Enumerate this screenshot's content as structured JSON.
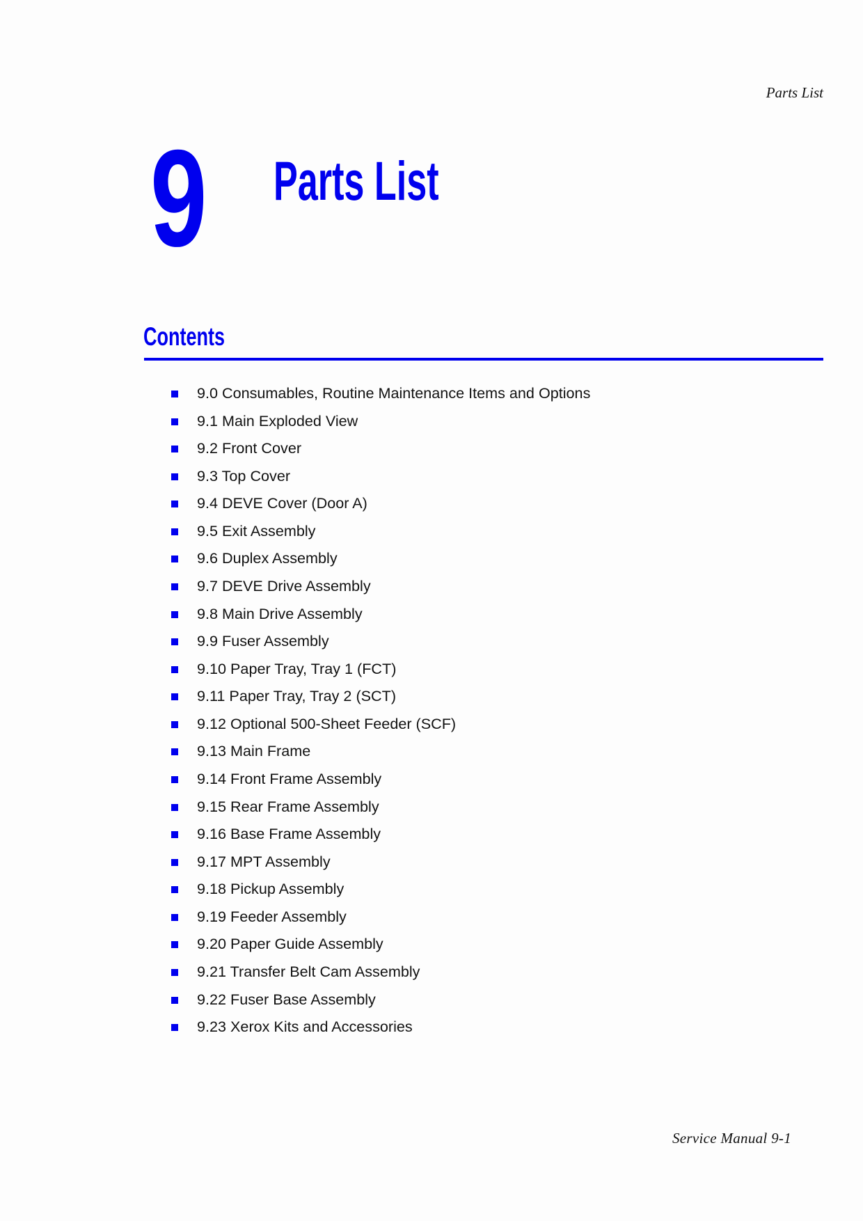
{
  "header": {
    "running_title": "Parts List"
  },
  "chapter": {
    "number": "9",
    "title": "Parts List"
  },
  "contents": {
    "heading": "Contents",
    "accent_color": "#0000ee",
    "items": [
      {
        "label": "9.0 Consumables, Routine Maintenance Items and Options"
      },
      {
        "label": "9.1 Main Exploded View"
      },
      {
        "label": "9.2 Front Cover"
      },
      {
        "label": "9.3 Top Cover"
      },
      {
        "label": "9.4 DEVE Cover (Door A)"
      },
      {
        "label": "9.5 Exit Assembly"
      },
      {
        "label": "9.6 Duplex Assembly"
      },
      {
        "label": "9.7 DEVE Drive Assembly"
      },
      {
        "label": "9.8 Main Drive Assembly"
      },
      {
        "label": "9.9 Fuser Assembly"
      },
      {
        "label": "9.10 Paper Tray, Tray 1 (FCT)"
      },
      {
        "label": "9.11 Paper Tray, Tray 2 (SCT)"
      },
      {
        "label": "9.12 Optional 500-Sheet Feeder (SCF)"
      },
      {
        "label": "9.13 Main Frame"
      },
      {
        "label": "9.14 Front Frame Assembly"
      },
      {
        "label": "9.15 Rear Frame Assembly"
      },
      {
        "label": "9.16 Base Frame Assembly"
      },
      {
        "label": "9.17 MPT Assembly"
      },
      {
        "label": "9.18 Pickup Assembly"
      },
      {
        "label": "9.19 Feeder Assembly"
      },
      {
        "label": "9.20 Paper Guide Assembly"
      },
      {
        "label": "9.21 Transfer Belt Cam Assembly"
      },
      {
        "label": "9.22 Fuser Base Assembly"
      },
      {
        "label": "9.23 Xerox Kits and Accessories"
      }
    ]
  },
  "footer": {
    "text": "Service Manual 9-1"
  }
}
